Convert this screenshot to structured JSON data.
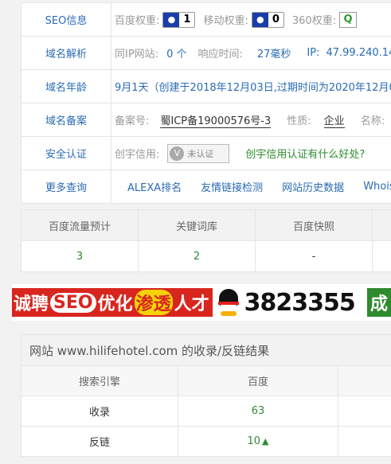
{
  "info": {
    "seo": {
      "label": "SEO信息",
      "baidu_label": "百度权重:",
      "baidu_value": "1",
      "mobile_label": "移动权重:",
      "mobile_value": "0",
      "s360_label": "360权重:"
    },
    "dns": {
      "label": "域名解析",
      "same_ip_label": "同IP网站:",
      "same_ip_value": "0 个",
      "resp_label": "响应时间:",
      "resp_value": "27毫秒",
      "ip_label": "IP:",
      "ip_value": "47.99.240.14"
    },
    "age": {
      "label": "域名年龄",
      "text": "9月1天（创建于2018年12月03日,过期时间为2020年12月03"
    },
    "icp": {
      "label": "域名备案",
      "no_label": "备案号:",
      "no_value": "蜀ICP备19000576号-3",
      "nature_label": "性质:",
      "nature_value": "企业",
      "name_label": "名称:"
    },
    "security": {
      "label": "安全认证",
      "credit_label": "创宇信用:",
      "stamp_text": "未认证",
      "stamp_icon": "V",
      "link_text": "创宇信用认证有什么好处?"
    },
    "more": {
      "label": "更多查询",
      "links": [
        "ALEXA排名",
        "友情链接检测",
        "网站历史数据",
        "Whois"
      ]
    }
  },
  "stats": {
    "headers": [
      "百度流量预计",
      "关键词库",
      "百度快照"
    ],
    "values": [
      "3",
      "2",
      "-"
    ]
  },
  "banner": {
    "part1": "诚聘",
    "seo": "SEO",
    "part2": "优化",
    "part3": "渗透",
    "part4": "人才",
    "phone": "3823355",
    "tail": "成"
  },
  "result": {
    "title": "网站 www.hilifehotel.com 的收录/反链结果",
    "headers": [
      "搜索引擎",
      "百度"
    ],
    "rows": [
      {
        "name": "收录",
        "baidu": "63"
      },
      {
        "name": "反链",
        "baidu": "10"
      }
    ]
  },
  "colors": {
    "link": "#2a6bb4",
    "green": "#2e8b2e",
    "banner_red": "#d8261f",
    "baidu_blue": "#1a3ea8"
  }
}
